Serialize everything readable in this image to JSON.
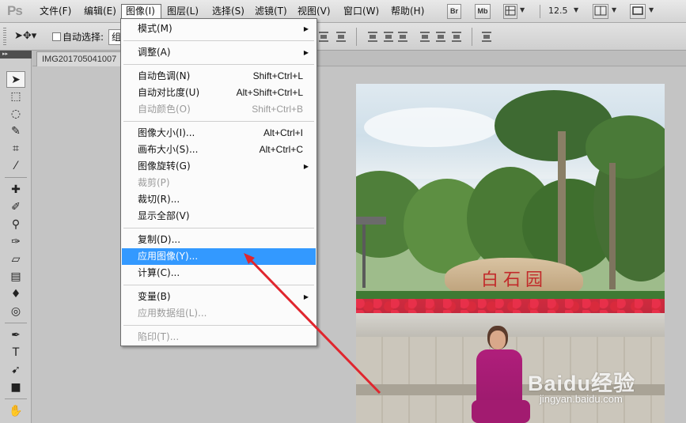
{
  "app": {
    "logo": "Ps"
  },
  "menubar": {
    "items": [
      "文件(F)",
      "编辑(E)",
      "图像(I)",
      "图层(L)",
      "选择(S)",
      "滤镜(T)",
      "视图(V)",
      "窗口(W)",
      "帮助(H)"
    ],
    "active_index": 2,
    "buttons": {
      "bridge": "Br",
      "mini_bridge": "Mb"
    },
    "zoom": "12.5"
  },
  "options": {
    "auto_select_label": "自动选择:",
    "auto_select_value": "组"
  },
  "document": {
    "tab_title": "IMG201705041007"
  },
  "image_menu": {
    "groups": [
      [
        {
          "label": "模式(M)",
          "submenu": true
        }
      ],
      [
        {
          "label": "调整(A)",
          "submenu": true
        }
      ],
      [
        {
          "label": "自动色调(N)",
          "shortcut": "Shift+Ctrl+L"
        },
        {
          "label": "自动对比度(U)",
          "shortcut": "Alt+Shift+Ctrl+L"
        },
        {
          "label": "自动颜色(O)",
          "shortcut": "Shift+Ctrl+B",
          "disabled": true
        }
      ],
      [
        {
          "label": "图像大小(I)...",
          "shortcut": "Alt+Ctrl+I"
        },
        {
          "label": "画布大小(S)...",
          "shortcut": "Alt+Ctrl+C"
        },
        {
          "label": "图像旋转(G)",
          "submenu": true
        },
        {
          "label": "裁剪(P)",
          "disabled": true
        },
        {
          "label": "裁切(R)..."
        },
        {
          "label": "显示全部(V)"
        }
      ],
      [
        {
          "label": "复制(D)..."
        },
        {
          "label": "应用图像(Y)...",
          "highlight": true
        },
        {
          "label": "计算(C)..."
        }
      ],
      [
        {
          "label": "变量(B)",
          "submenu": true
        },
        {
          "label": "应用数据组(L)...",
          "disabled": true
        }
      ],
      [
        {
          "label": "陷印(T)...",
          "disabled": true
        }
      ]
    ]
  },
  "photo": {
    "sign_text": "白石园",
    "watermark": "Baidu经验",
    "watermark_url": "jingyan.baidu.com"
  },
  "colors": {
    "menu_highlight": "#3399ff",
    "annotation_arrow": "#e0262e",
    "sign_text": "#c22a2a"
  }
}
